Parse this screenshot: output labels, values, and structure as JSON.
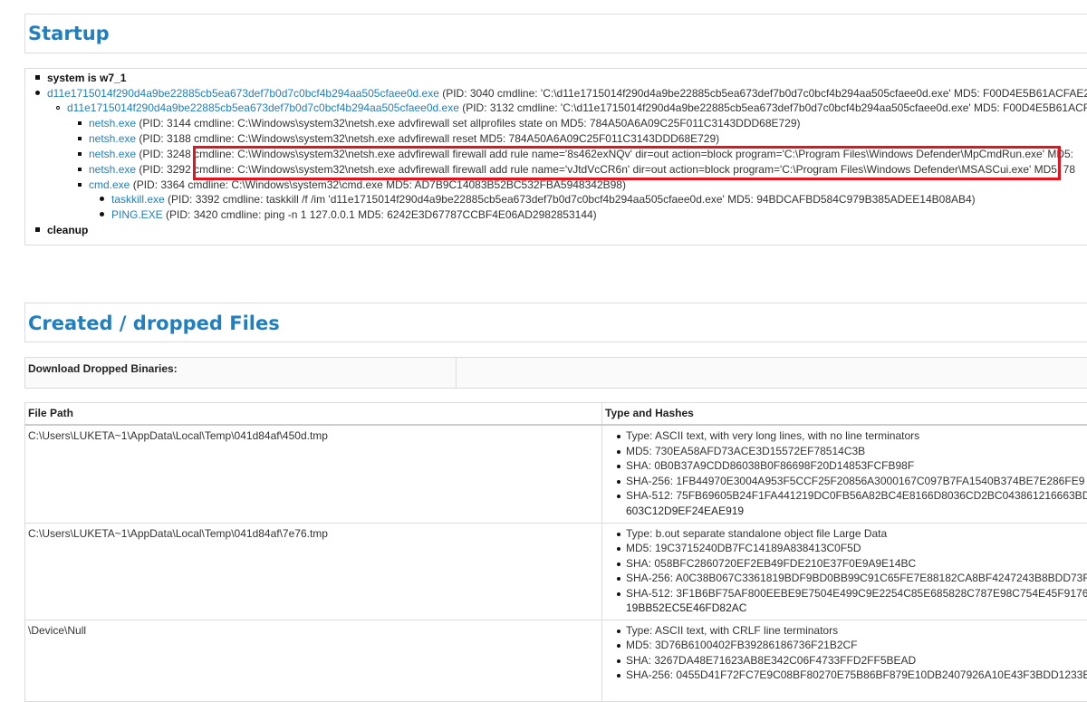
{
  "startup": {
    "title": "Startup",
    "system_label": "system is w7_1",
    "cleanup_label": "cleanup",
    "processes": [
      {
        "name": "d11e1715014f290d4a9be22885cb5ea673def7b0d7c0bcf4b294aa505cfaee0d.exe",
        "detail": " (PID: 3040 cmdline: 'C:\\d11e1715014f290d4a9be22885cb5ea673def7b0d7c0bcf4b294aa505cfaee0d.exe'  MD5: F00D4E5B61ACFAE2"
      },
      {
        "name": "d11e1715014f290d4a9be22885cb5ea673def7b0d7c0bcf4b294aa505cfaee0d.exe",
        "detail": " (PID: 3132 cmdline: 'C:\\d11e1715014f290d4a9be22885cb5ea673def7b0d7c0bcf4b294aa505cfaee0d.exe'  MD5: F00D4E5B61ACF"
      },
      {
        "name": "netsh.exe",
        "detail": " (PID: 3144 cmdline: C:\\Windows\\system32\\netsh.exe advfirewall set allprofiles state on MD5: 784A50A6A09C25F011C3143DDD68E729)"
      },
      {
        "name": "netsh.exe",
        "detail": " (PID: 3188 cmdline: C:\\Windows\\system32\\netsh.exe advfirewall reset MD5: 784A50A6A09C25F011C3143DDD68E729)"
      },
      {
        "name": "netsh.exe",
        "detail": " (PID: 3248 cmdline: C:\\Windows\\system32\\netsh.exe advfirewall firewall add rule name='8s462exNQv' dir=out action=block program='C:\\Program Files\\Windows Defender\\MpCmdRun.exe' MD5:"
      },
      {
        "name": "netsh.exe",
        "detail": " (PID: 3292 cmdline: C:\\Windows\\system32\\netsh.exe advfirewall firewall add rule name='vJtdVcCR6n' dir=out action=block program='C:\\Program Files\\Windows Defender\\MSASCui.exe' MD5: 78"
      },
      {
        "name": "cmd.exe",
        "detail": " (PID: 3364 cmdline: C:\\Windows\\system32\\cmd.exe MD5: AD7B9C14083B52BC532FBA5948342B98)"
      },
      {
        "name": "taskkill.exe",
        "detail": " (PID: 3392 cmdline: taskkill  /f /im 'd11e1715014f290d4a9be22885cb5ea673def7b0d7c0bcf4b294aa505cfaee0d.exe'   MD5: 94BDCAFBD584C979B385ADEE14B08AB4)"
      },
      {
        "name": "PING.EXE",
        "detail": " (PID: 3420 cmdline: ping  -n 1 127.0.0.1   MD5: 6242E3D67787CCBF4E06AD2982853144)"
      }
    ]
  },
  "dropped": {
    "title": "Created / dropped Files",
    "download_label": "Download Dropped Binaries:",
    "columns": [
      "File Path",
      "Type and Hashes"
    ],
    "files": [
      {
        "path": "C:\\Users\\LUKETA~1\\AppData\\Local\\Temp\\041d84af\\450d.tmp",
        "type": "Type: ASCII text, with very long lines, with no line terminators",
        "md5": "MD5: 730EA58AFD73ACE3D15572EF78514C3B",
        "sha": "SHA: 0B0B37A9CDD86038B0F86698F20D14853FCFB98F",
        "sha256": "SHA-256: 1FB44970E3004A953F5CCF25F20856A3000167C097B7FA1540B374BE7E286FE9",
        "sha512": "SHA-512: 75FB69605B24F1FA441219DC0FB56A82BC4E8166D8036CD2BC043861216663BD0",
        "sha512_cont": "603C12D9EF24EAE919"
      },
      {
        "path": "C:\\Users\\LUKETA~1\\AppData\\Local\\Temp\\041d84af\\7e76.tmp",
        "type": "Type: b.out separate standalone object file Large Data",
        "md5": "MD5: 19C3715240DB7FC14189A838413C0F5D",
        "sha": "SHA: 058BFC2860720EF2EB49FDE210E37F0E9A9E14BC",
        "sha256": "SHA-256: A0C38B067C3361819BDF9BD0BB99C91C65FE7E88182CA8BF4247243B8BDD73F6",
        "sha512": "SHA-512: 3F1B6BF75AF800EEBE9E7504E499C9E2254C85E685828C787E98C754E45F91764",
        "sha512_cont": "19BB52EC5E46FD82AC"
      },
      {
        "path": "\\Device\\Null",
        "type": "Type: ASCII text, with CRLF line terminators",
        "md5": "MD5: 3D76B6100402FB39286186736F21B2CF",
        "sha": "SHA: 3267DA48E71623AB8E342C06F4733FFD2FF5BEAD",
        "sha256": "SHA-256: 0455D41F72FC7E9C08BF80270E75B86BF879E10DB2407926A10E43F3BDD1233E"
      }
    ]
  }
}
